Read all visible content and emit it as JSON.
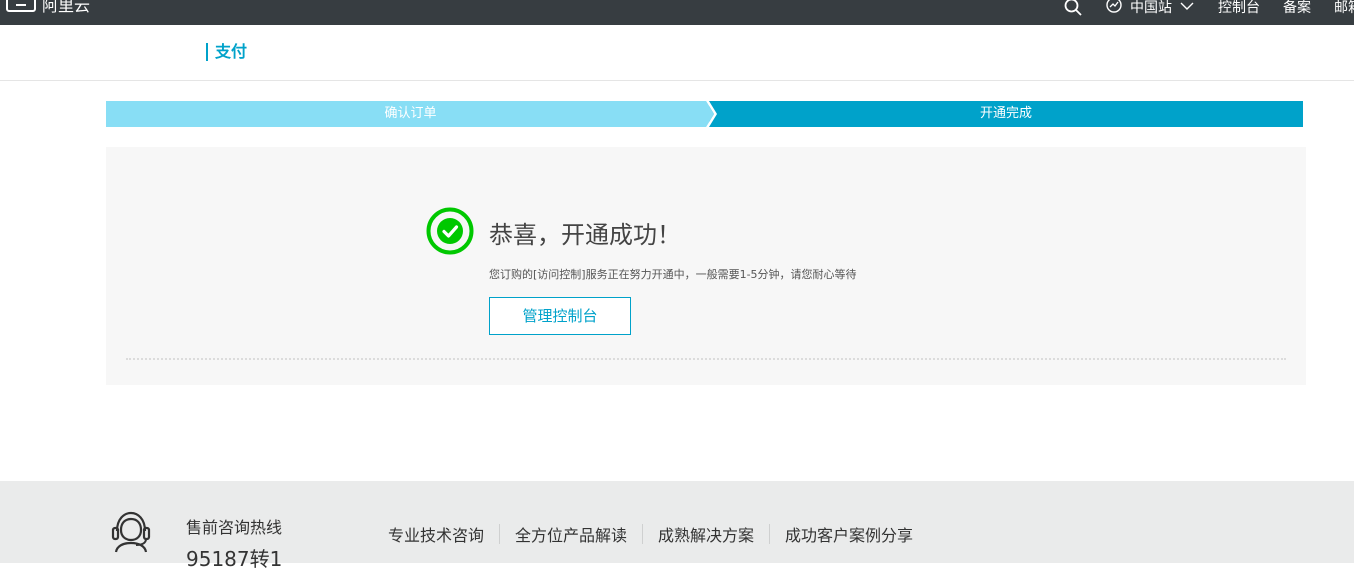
{
  "topbar": {
    "logo_text": "阿里云",
    "region": "中国站",
    "links": [
      "控制台",
      "备案",
      "邮箱"
    ],
    "icons": {
      "search": "search-icon",
      "region": "globe-icon",
      "dropdown": "chevron-down-icon"
    }
  },
  "header": {
    "title": "支付"
  },
  "steps": {
    "step1": "确认订单",
    "step2": "开通完成"
  },
  "result": {
    "title": "恭喜，开通成功！",
    "description": "您订购的[访问控制]服务正在努力开通中，一般需要1-5分钟，请您耐心等待",
    "button": "管理控制台"
  },
  "footer": {
    "hotline_label": "售前咨询热线",
    "hotline_number": "95187转1",
    "links": [
      "专业技术咨询",
      "全方位产品解读",
      "成熟解决方案",
      "成功客户案例分享"
    ]
  },
  "colors": {
    "accent": "#00a2ca",
    "step_inactive": "#88def5",
    "success": "#00c800",
    "topbar": "#373d41"
  }
}
